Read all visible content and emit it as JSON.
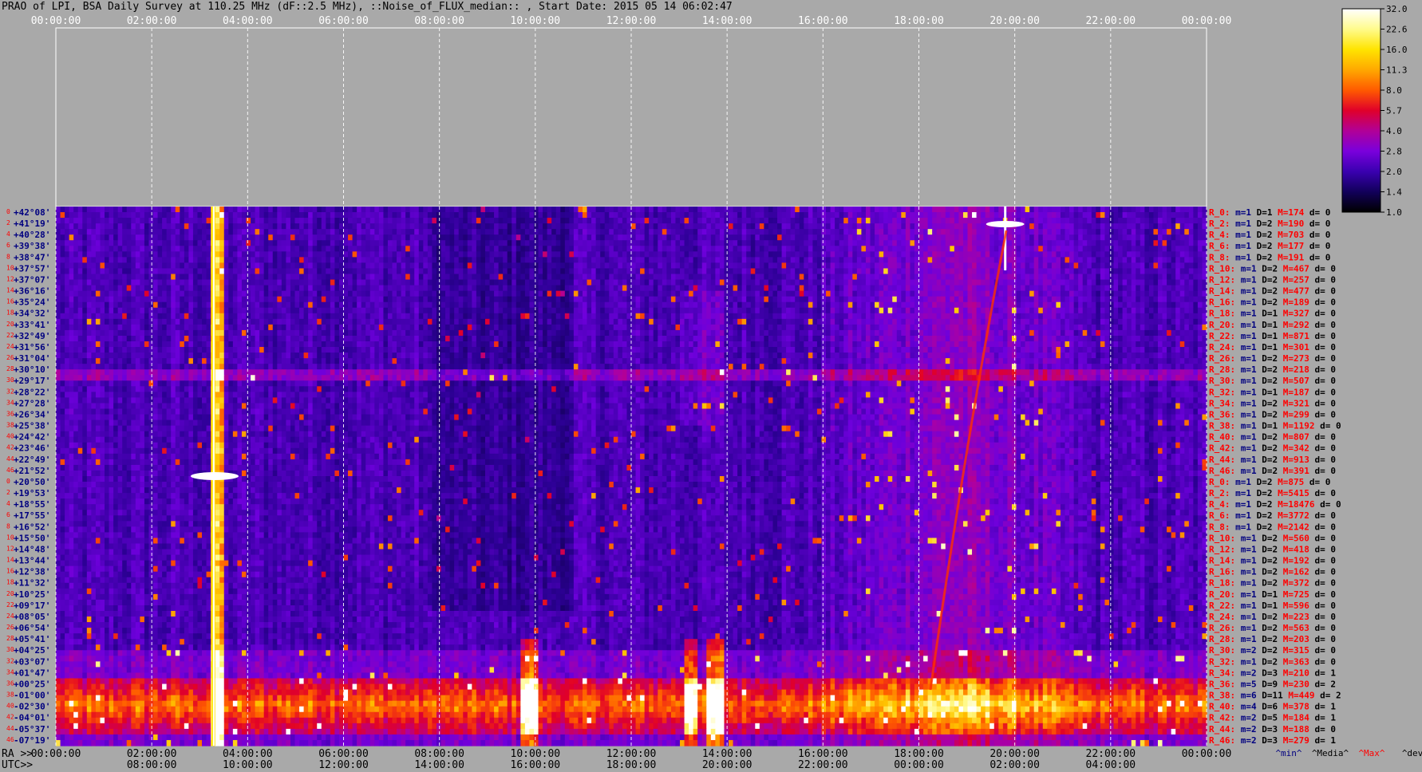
{
  "title": "PRAO of LPI, BSA Daily Survey at 110.25 MHz (dF::2.5 MHz), ::Noise_of_FLUX_median:: , Start Date: 2015 05 14 06:02:47",
  "chart_data": {
    "type": "heatmap",
    "title": "PRAO of LPI, BSA Daily Survey at 110.25 MHz (dF::2.5 MHz), ::Noise_of_FLUX_median:: , Start Date: 2015 05 14 06:02:47",
    "x_top_ticks": [
      "00:00:00",
      "02:00:00",
      "04:00:00",
      "06:00:00",
      "08:00:00",
      "10:00:00",
      "12:00:00",
      "14:00:00",
      "16:00:00",
      "18:00:00",
      "20:00:00",
      "22:00:00",
      "00:00:00"
    ],
    "x_ra_label": "RA >>",
    "x_ra_ticks": [
      "00:00:00",
      "02:00:00",
      "04:00:00",
      "06:00:00",
      "08:00:00",
      "10:00:00",
      "12:00:00",
      "14:00:00",
      "16:00:00",
      "18:00:00",
      "20:00:00",
      "22:00:00",
      "00:00:00"
    ],
    "x_utc_label": "UTC>>",
    "x_utc_ticks": [
      "08:00:00",
      "10:00:00",
      "12:00:00",
      "14:00:00",
      "16:00:00",
      "18:00:00",
      "20:00:00",
      "22:00:00",
      "00:00:00",
      "02:00:00",
      "04:00:00"
    ],
    "declinations": [
      "+42°08'",
      "+41°19'",
      "+40°28'",
      "+39°38'",
      "+38°47'",
      "+37°57'",
      "+37°07'",
      "+36°16'",
      "+35°24'",
      "+34°32'",
      "+33°41'",
      "+32°49'",
      "+31°56'",
      "+31°04'",
      "+30°10'",
      "+29°17'",
      "+28°22'",
      "+27°28'",
      "+26°34'",
      "+25°38'",
      "+24°42'",
      "+23°46'",
      "+22°49'",
      "+21°52'",
      "+20°50'",
      "+19°53'",
      "+18°55'",
      "+17°55'",
      "+16°52'",
      "+15°50'",
      "+14°48'",
      "+13°44'",
      "+12°38'",
      "+11°32'",
      "+10°25'",
      "+09°17'",
      "+08°05'",
      "+06°54'",
      "+05°41'",
      "+04°25'",
      "+03°07'",
      "+01°47'",
      "+00°25'",
      "-01°00'",
      "-02°30'",
      "-04°01'",
      "-05°37'",
      "-07°19'"
    ],
    "row_indices": [
      "0",
      "2",
      "4",
      "6",
      "8",
      "10",
      "12",
      "14",
      "16",
      "18",
      "20",
      "22",
      "24",
      "26",
      "28",
      "30",
      "32",
      "34",
      "36",
      "38",
      "40",
      "42",
      "44",
      "46",
      "0",
      "2",
      "4",
      "6",
      "8",
      "10",
      "12",
      "14",
      "16",
      "18",
      "20",
      "22",
      "24",
      "26",
      "28",
      "30",
      "32",
      "34",
      "36",
      "38",
      "40",
      "42",
      "44",
      "46"
    ],
    "row_stats": [
      {
        "r": "R_0:",
        "m": "1",
        "D": "1",
        "M": "174",
        "d": "0"
      },
      {
        "r": "R_2:",
        "m": "1",
        "D": "2",
        "M": "190",
        "d": "0"
      },
      {
        "r": "R_4:",
        "m": "1",
        "D": "2",
        "M": "703",
        "d": "0"
      },
      {
        "r": "R_6:",
        "m": "1",
        "D": "2",
        "M": "177",
        "d": "0"
      },
      {
        "r": "R_8:",
        "m": "1",
        "D": "2",
        "M": "191",
        "d": "0"
      },
      {
        "r": "R_10:",
        "m": "1",
        "D": "2",
        "M": "467",
        "d": "0"
      },
      {
        "r": "R_12:",
        "m": "1",
        "D": "2",
        "M": "257",
        "d": "0"
      },
      {
        "r": "R_14:",
        "m": "1",
        "D": "2",
        "M": "477",
        "d": "0"
      },
      {
        "r": "R_16:",
        "m": "1",
        "D": "2",
        "M": "189",
        "d": "0"
      },
      {
        "r": "R_18:",
        "m": "1",
        "D": "1",
        "M": "327",
        "d": "0"
      },
      {
        "r": "R_20:",
        "m": "1",
        "D": "1",
        "M": "292",
        "d": "0"
      },
      {
        "r": "R_22:",
        "m": "1",
        "D": "1",
        "M": "871",
        "d": "0"
      },
      {
        "r": "R_24:",
        "m": "1",
        "D": "1",
        "M": "301",
        "d": "0"
      },
      {
        "r": "R_26:",
        "m": "1",
        "D": "2",
        "M": "273",
        "d": "0"
      },
      {
        "r": "R_28:",
        "m": "1",
        "D": "2",
        "M": "218",
        "d": "0"
      },
      {
        "r": "R_30:",
        "m": "1",
        "D": "2",
        "M": "507",
        "d": "0"
      },
      {
        "r": "R_32:",
        "m": "1",
        "D": "1",
        "M": "187",
        "d": "0"
      },
      {
        "r": "R_34:",
        "m": "1",
        "D": "2",
        "M": "321",
        "d": "0"
      },
      {
        "r": "R_36:",
        "m": "1",
        "D": "2",
        "M": "299",
        "d": "0"
      },
      {
        "r": "R_38:",
        "m": "1",
        "D": "1",
        "M": "1192",
        "d": "0"
      },
      {
        "r": "R_40:",
        "m": "1",
        "D": "2",
        "M": "807",
        "d": "0"
      },
      {
        "r": "R_42:",
        "m": "1",
        "D": "2",
        "M": "342",
        "d": "0"
      },
      {
        "r": "R_44:",
        "m": "1",
        "D": "2",
        "M": "913",
        "d": "0"
      },
      {
        "r": "R_46:",
        "m": "1",
        "D": "2",
        "M": "391",
        "d": "0"
      },
      {
        "r": "R_0:",
        "m": "1",
        "D": "2",
        "M": "875",
        "d": "0"
      },
      {
        "r": "R_2:",
        "m": "1",
        "D": "2",
        "M": "5415",
        "d": "0"
      },
      {
        "r": "R_4:",
        "m": "1",
        "D": "2",
        "M": "18476",
        "d": "0"
      },
      {
        "r": "R_6:",
        "m": "1",
        "D": "2",
        "M": "3772",
        "d": "0"
      },
      {
        "r": "R_8:",
        "m": "1",
        "D": "2",
        "M": "2142",
        "d": "0"
      },
      {
        "r": "R_10:",
        "m": "1",
        "D": "2",
        "M": "560",
        "d": "0"
      },
      {
        "r": "R_12:",
        "m": "1",
        "D": "2",
        "M": "418",
        "d": "0"
      },
      {
        "r": "R_14:",
        "m": "1",
        "D": "2",
        "M": "192",
        "d": "0"
      },
      {
        "r": "R_16:",
        "m": "1",
        "D": "2",
        "M": "162",
        "d": "0"
      },
      {
        "r": "R_18:",
        "m": "1",
        "D": "2",
        "M": "372",
        "d": "0"
      },
      {
        "r": "R_20:",
        "m": "1",
        "D": "1",
        "M": "725",
        "d": "0"
      },
      {
        "r": "R_22:",
        "m": "1",
        "D": "1",
        "M": "596",
        "d": "0"
      },
      {
        "r": "R_24:",
        "m": "1",
        "D": "2",
        "M": "223",
        "d": "0"
      },
      {
        "r": "R_26:",
        "m": "1",
        "D": "2",
        "M": "563",
        "d": "0"
      },
      {
        "r": "R_28:",
        "m": "1",
        "D": "2",
        "M": "203",
        "d": "0"
      },
      {
        "r": "R_30:",
        "m": "2",
        "D": "2",
        "M": "315",
        "d": "0"
      },
      {
        "r": "R_32:",
        "m": "1",
        "D": "2",
        "M": "363",
        "d": "0"
      },
      {
        "r": "R_34:",
        "m": "2",
        "D": "3",
        "M": "210",
        "d": "1"
      },
      {
        "r": "R_36:",
        "m": "5",
        "D": "9",
        "M": "230",
        "d": "2"
      },
      {
        "r": "R_38:",
        "m": "6",
        "D": "11",
        "M": "449",
        "d": "2"
      },
      {
        "r": "R_40:",
        "m": "4",
        "D": "6",
        "M": "378",
        "d": "1"
      },
      {
        "r": "R_42:",
        "m": "2",
        "D": "5",
        "M": "184",
        "d": "1"
      },
      {
        "r": "R_44:",
        "m": "2",
        "D": "3",
        "M": "188",
        "d": "0"
      },
      {
        "r": "R_46:",
        "m": "2",
        "D": "3",
        "M": "279",
        "d": "1"
      }
    ],
    "stat_legend": [
      "^min^",
      "^Media^",
      "^Max^",
      "^devia^"
    ],
    "colorbar": {
      "ticks": [
        "32.0",
        "22.6",
        "16.0",
        "11.3",
        "8.0",
        "5.7",
        "4.0",
        "2.8",
        "2.0",
        "1.4",
        "1.0"
      ],
      "colors": [
        "#ffffff",
        "#fffb8c",
        "#ffe400",
        "#ffa800",
        "#ff5a00",
        "#e0002a",
        "#b10097",
        "#7a00dc",
        "#3a00b0",
        "#12005a",
        "#000000"
      ]
    },
    "grid": true,
    "label_colors": {
      "dec": "#000080",
      "index": "#ff0000",
      "min": "#000080",
      "max": "#ff0000",
      "d": "#000000"
    }
  }
}
